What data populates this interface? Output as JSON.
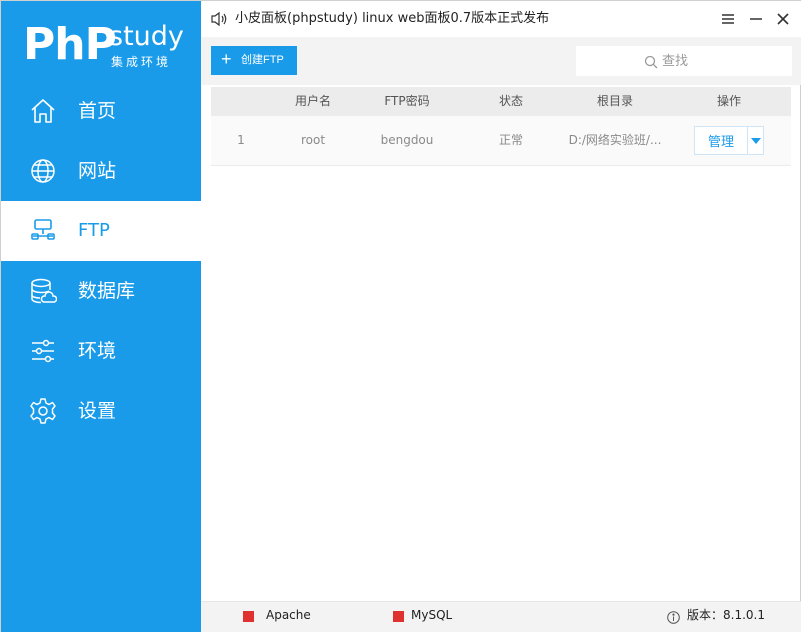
{
  "logo": {
    "main": "PhP",
    "word": "study",
    "subtitle": "集成环境"
  },
  "sidebar": {
    "items": [
      {
        "label": "首页",
        "icon": "home-icon",
        "active": false
      },
      {
        "label": "网站",
        "icon": "globe-icon",
        "active": false
      },
      {
        "label": "FTP",
        "icon": "ftp-icon",
        "active": true
      },
      {
        "label": "数据库",
        "icon": "database-icon",
        "active": false
      },
      {
        "label": "环境",
        "icon": "sliders-icon",
        "active": false
      },
      {
        "label": "设置",
        "icon": "gear-icon",
        "active": false
      }
    ]
  },
  "titlebar": {
    "announcement": "小皮面板(phpstudy) linux web面板0.7版本正式发布",
    "icons": [
      "speaker-icon",
      "menu-icon",
      "minimize-icon",
      "close-icon"
    ]
  },
  "toolbar": {
    "create_label": "创建FTP",
    "search_placeholder": "查找"
  },
  "table": {
    "headers": [
      "用户名",
      "FTP密码",
      "状态",
      "根目录",
      "操作"
    ],
    "rows": [
      {
        "index": "1",
        "username": "root",
        "password": "bengdou",
        "status": "正常",
        "root_dir": "D:/网络实验班/...",
        "action": "管理"
      }
    ]
  },
  "statusbar": {
    "services": [
      {
        "name": "Apache",
        "color": "#e03131"
      },
      {
        "name": "MySQL",
        "color": "#e03131"
      }
    ],
    "version_text": "版本：8.1.0.1"
  },
  "colors": {
    "accent": "#1a9bea",
    "stopped": "#e03131"
  }
}
